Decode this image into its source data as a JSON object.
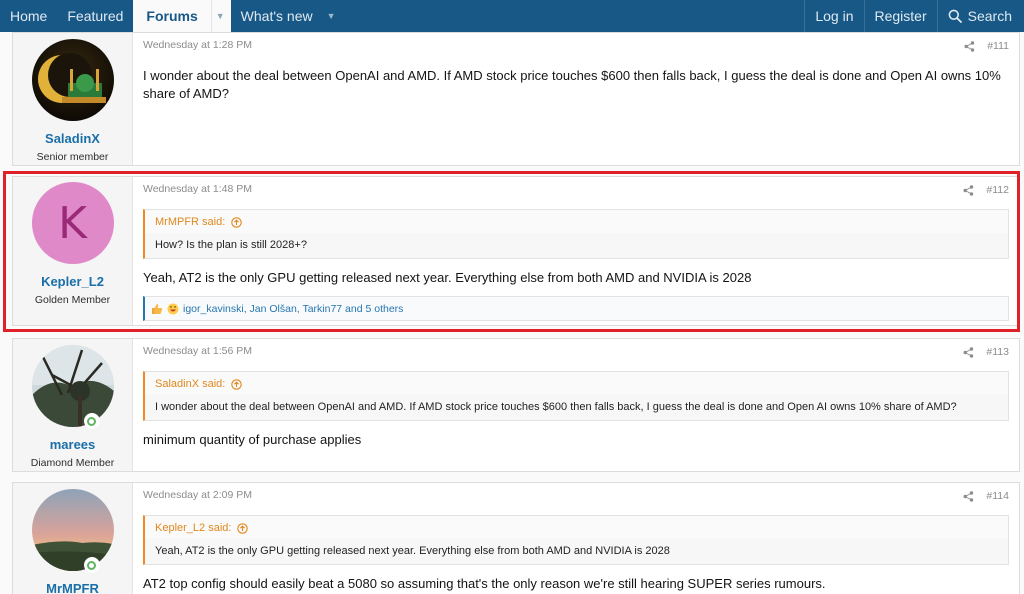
{
  "nav": {
    "items": [
      {
        "label": "Home"
      },
      {
        "label": "Featured"
      },
      {
        "label": "Forums"
      },
      {
        "label": "What's new"
      }
    ],
    "login_label": "Log in",
    "register_label": "Register",
    "search_label": "Search"
  },
  "colors": {
    "nav_bg": "#185886",
    "username": "#1a6fa9",
    "quote_accent": "#f08a20",
    "reaction_accent": "#2577b1",
    "highlight": "#e0212a"
  },
  "posts": [
    {
      "username": "SaladinX",
      "user_title": "Senior member",
      "avatar": "mosque-crescent-avatar",
      "time": "Wednesday at 1:28 PM",
      "number": "#111",
      "message": "I wonder about the deal between OpenAI and AMD. If AMD stock price touches $600 then falls back, I guess the deal is done and Open AI owns 10% share of AMD?"
    },
    {
      "username": "Kepler_L2",
      "user_title": "Golden Member",
      "avatar_letter": "K",
      "time": "Wednesday at 1:48 PM",
      "number": "#112",
      "quote_author": "MrMPFR said:",
      "quote_text": "How? Is the plan is still 2028+?",
      "message": "Yeah, AT2 is the only GPU getting released next year. Everything else from both AMD and NVIDIA is 2028",
      "reactions": "igor_kavinski, Jan Olšan, Tarkin77 and 5 others"
    },
    {
      "username": "marees",
      "user_title": "Diamond Member",
      "avatar": "tree-photo-avatar",
      "time": "Wednesday at 1:56 PM",
      "number": "#113",
      "quote_author": "SaladinX said:",
      "quote_text": "I wonder about the deal between OpenAI and AMD. If AMD stock price touches $600 then falls back, I guess the deal is done and Open AI owns 10% share of AMD?",
      "message": "minimum quantity of purchase applies"
    },
    {
      "username": "MrMPFR",
      "user_title": "",
      "avatar": "sunset-landscape-avatar",
      "time": "Wednesday at 2:09 PM",
      "number": "#114",
      "quote_author": "Kepler_L2 said:",
      "quote_text": "Yeah, AT2 is the only GPU getting released next year. Everything else from both AMD and NVIDIA is 2028",
      "message": "AT2 top config should easily beat a 5080 so assuming that's the only reason we're still hearing SUPER series rumours."
    }
  ]
}
